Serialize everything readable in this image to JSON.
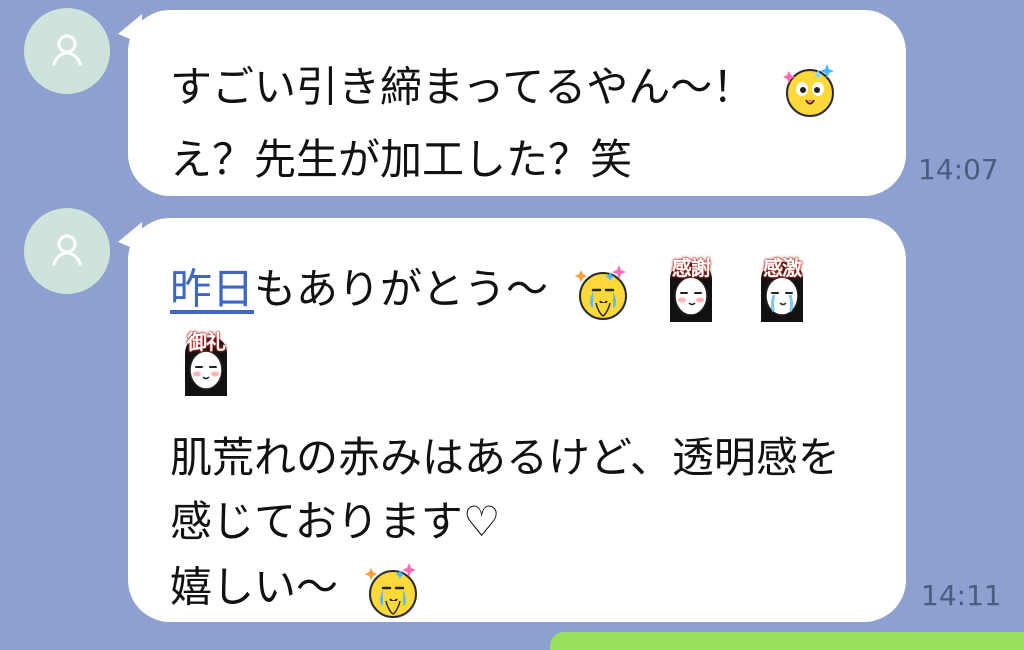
{
  "chat": {
    "messages": [
      {
        "lines": [
          {
            "text": "すごい引き締まってるやん〜！"
          },
          {
            "text": "え？先生が加工した？笑"
          }
        ],
        "time": "14:07"
      },
      {
        "lines": [
          {
            "link": "昨日",
            "text": "もありがとう〜"
          },
          {
            "text": ""
          },
          {
            "text": "肌荒れの赤みはあるけど、透明感を"
          },
          {
            "text": "感じております♡"
          },
          {
            "text": "嬉しい〜"
          }
        ],
        "time": "14:11",
        "stickers": [
          {
            "label": "感謝",
            "icon": "thanks-sticker-icon"
          },
          {
            "label": "感激",
            "icon": "moved-sticker-icon"
          },
          {
            "label": "御礼",
            "icon": "gratitude-sticker-icon"
          }
        ]
      }
    ]
  },
  "colors": {
    "background": "#8da0cf",
    "bubble": "#ffffff",
    "link": "#3f66c7",
    "timestamp": "#4b5c81",
    "avatar": "#cfe3dd",
    "outgoing": "#9be05a"
  }
}
